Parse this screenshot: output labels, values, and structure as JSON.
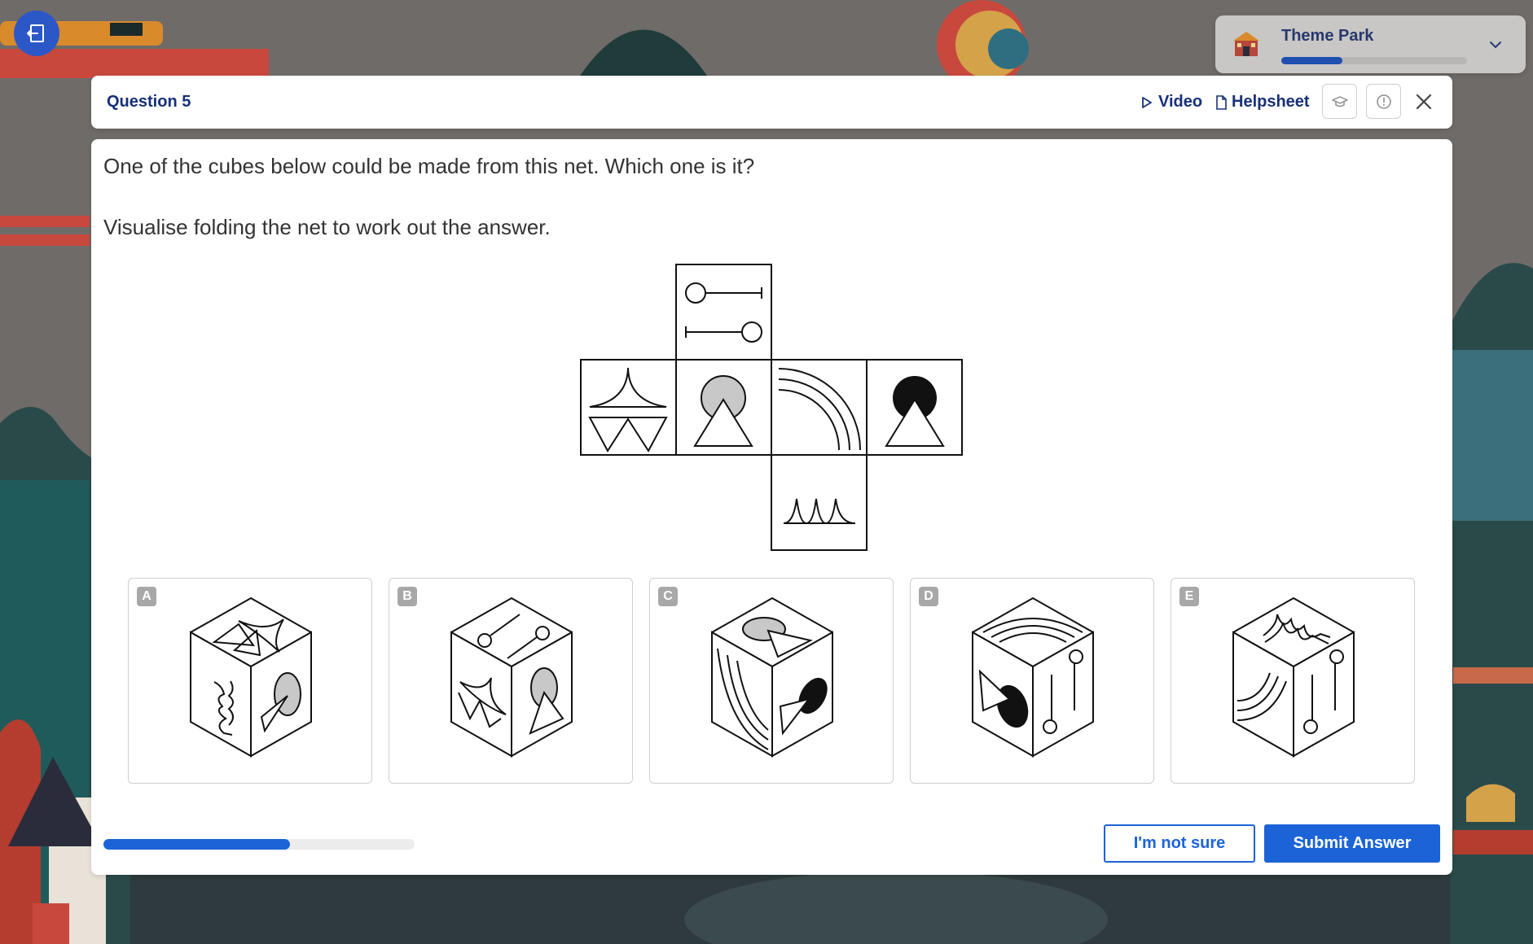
{
  "theme": {
    "name": "Theme Park",
    "progress_fraction": 0.33
  },
  "header": {
    "question_label": "Question 5",
    "video_label": "Video",
    "helpsheet_label": "Helpsheet"
  },
  "question": {
    "prompt": "One of the cubes below could be made from this net. Which one is it?",
    "instruction": "Visualise folding the net to work out the answer."
  },
  "options": [
    {
      "letter": "A"
    },
    {
      "letter": "B"
    },
    {
      "letter": "C"
    },
    {
      "letter": "D"
    },
    {
      "letter": "E"
    }
  ],
  "progress_fraction": 0.6,
  "buttons": {
    "not_sure": "I'm not sure",
    "submit": "Submit Answer"
  },
  "icons": [
    "exit-icon",
    "ferris-wheel-icon",
    "chevron-down-icon",
    "play-icon",
    "document-icon",
    "graduation-cap-icon",
    "info-icon",
    "close-icon"
  ]
}
